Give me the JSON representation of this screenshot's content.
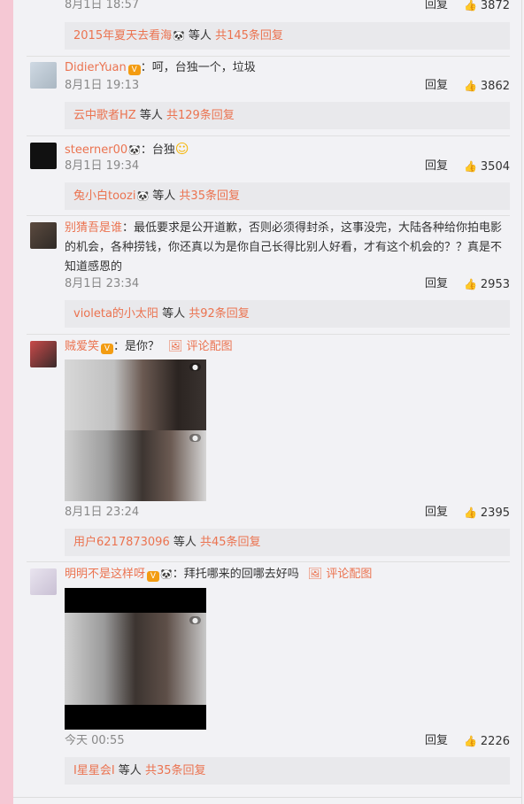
{
  "comments": [
    {
      "time": "8月1日 18:57",
      "reply": "回复",
      "likes": "3872",
      "sub": {
        "user": "2015年夏天去看海",
        "mid": " 等人 ",
        "count": "共145条回复"
      }
    },
    {
      "user": "DidierYuan",
      "text": "：呵，台独一个，垃圾",
      "time": "8月1日 19:13",
      "reply": "回复",
      "likes": "3862",
      "sub": {
        "user": "云中歌者HZ",
        "mid": " 等人 ",
        "count": "共129条回复"
      }
    },
    {
      "user": "steerner00",
      "text": "：台独",
      "time": "8月1日 19:34",
      "reply": "回复",
      "likes": "3504",
      "sub": {
        "user": "兔小白toozi",
        "mid": " 等人 ",
        "count": "共35条回复"
      }
    },
    {
      "user": "别猜吾是谁",
      "text": "：最低要求是公开道歉，否则必须得封杀，这事没完，大陆各种给你拍电影的机会，各种捞钱，你还真以为是你自己长得比别人好看，才有这个机会的？？真是不知道感恩的",
      "time": "8月1日 23:34",
      "reply": "回复",
      "likes": "2953",
      "sub": {
        "user": "violeta的小太阳",
        "mid": " 等人 ",
        "count": "共92条回复"
      }
    },
    {
      "user": "贼爱笑",
      "text": "：是你？",
      "piclink": "评论配图",
      "time": "8月1日 23:24",
      "reply": "回复",
      "likes": "2395",
      "sub": {
        "user": "用户6217873096",
        "mid": " 等人 ",
        "count": "共45条回复"
      }
    },
    {
      "user": "明明不是这样呀",
      "text": "：拜托哪来的回哪去好吗",
      "piclink": "评论配图",
      "time": "今天 00:55",
      "reply": "回复",
      "likes": "2226",
      "sub": {
        "user": "I星星会I",
        "mid": " 等人 ",
        "count": "共35条回复"
      }
    }
  ],
  "icons": {
    "like": "thumbs-up-icon",
    "pic": "image-icon",
    "badge": "vip-badge-icon",
    "panda": "panda-emoji-icon",
    "smiley": "smiley-emoji-icon"
  },
  "colors": {
    "link": "#eb7350",
    "accent_bar": "#f5c8d4",
    "sub_bg": "#e9e9ec"
  }
}
